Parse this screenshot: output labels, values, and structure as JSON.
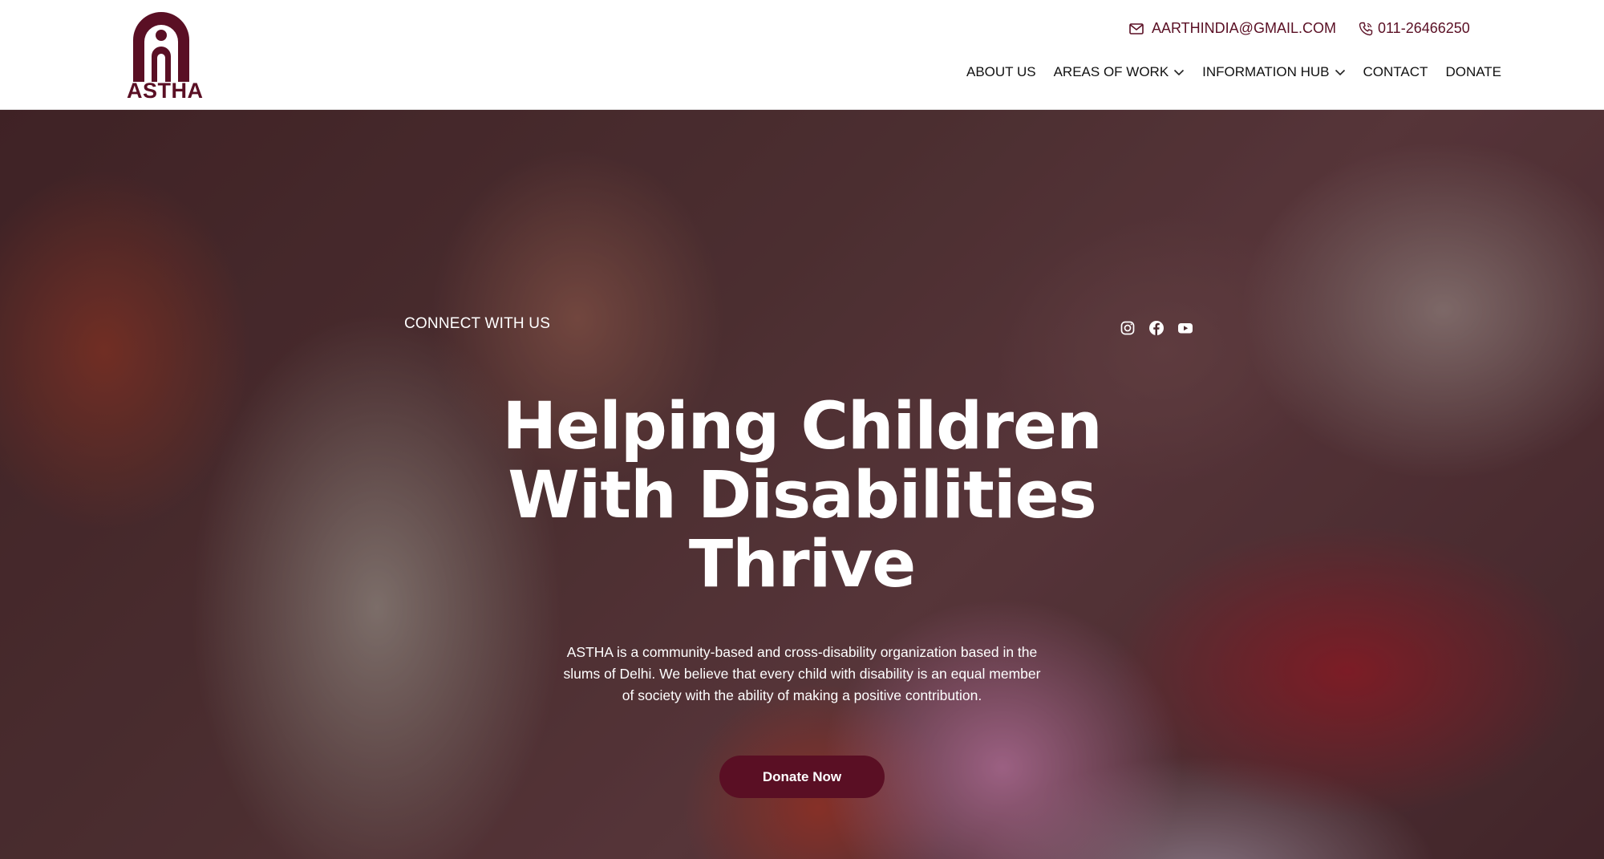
{
  "brand": {
    "name": "ASTHA",
    "color": "#5a0f24"
  },
  "header": {
    "email": "AARTHINDIA@GMAIL.COM",
    "phone": "011-26466250",
    "nav": [
      {
        "label": "ABOUT US",
        "has_dropdown": false
      },
      {
        "label": "AREAS OF WORK",
        "has_dropdown": true
      },
      {
        "label": "INFORMATION HUB",
        "has_dropdown": true
      },
      {
        "label": "CONTACT",
        "has_dropdown": false
      },
      {
        "label": "DONATE",
        "has_dropdown": false
      }
    ]
  },
  "hero": {
    "connect_label": "CONNECT WITH US",
    "social_icons": [
      "instagram-icon",
      "facebook-icon",
      "youtube-icon"
    ],
    "title_lines": [
      "Helping Children",
      "With Disabilities",
      "Thrive"
    ],
    "description": "ASTHA is a community-based and cross-disability organization based in the slums of Delhi. We believe that every child with disability is an equal member of society with the ability of making a positive contribution.",
    "cta_label": "Donate Now"
  }
}
